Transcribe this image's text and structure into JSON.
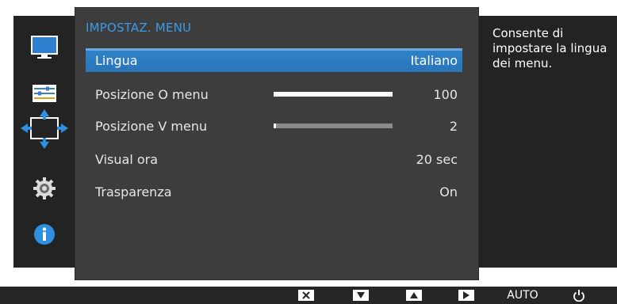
{
  "menu": {
    "title": "IMPOSTAZ. MENU",
    "items": [
      {
        "label": "Lingua",
        "value": "Italiano",
        "selected": true
      },
      {
        "label": "Posizione O menu",
        "value": "100",
        "bar_fraction": 1.0
      },
      {
        "label": "Posizione V menu",
        "value": "2",
        "bar_fraction": 0.02
      },
      {
        "label": "Visual ora",
        "value": "20 sec"
      },
      {
        "label": "Trasparenza",
        "value": "On"
      }
    ]
  },
  "help_text": "Consente di impostare la lingua dei menu.",
  "sidebar": {
    "icons": [
      "monitor-icon",
      "sliders-icon",
      "position-arrows-icon",
      "gear-icon",
      "info-icon"
    ],
    "active": "position-arrows-icon"
  },
  "bottom_bar": {
    "buttons": [
      "close-icon",
      "down-arrow-icon",
      "up-arrow-icon",
      "right-arrow-icon",
      "AUTO",
      "power-icon"
    ],
    "auto_label": "AUTO"
  },
  "colors": {
    "accent": "#3a9be8",
    "selected_row": "#2f82c7",
    "panel": "#3d3d3d",
    "frame": "#232323"
  }
}
